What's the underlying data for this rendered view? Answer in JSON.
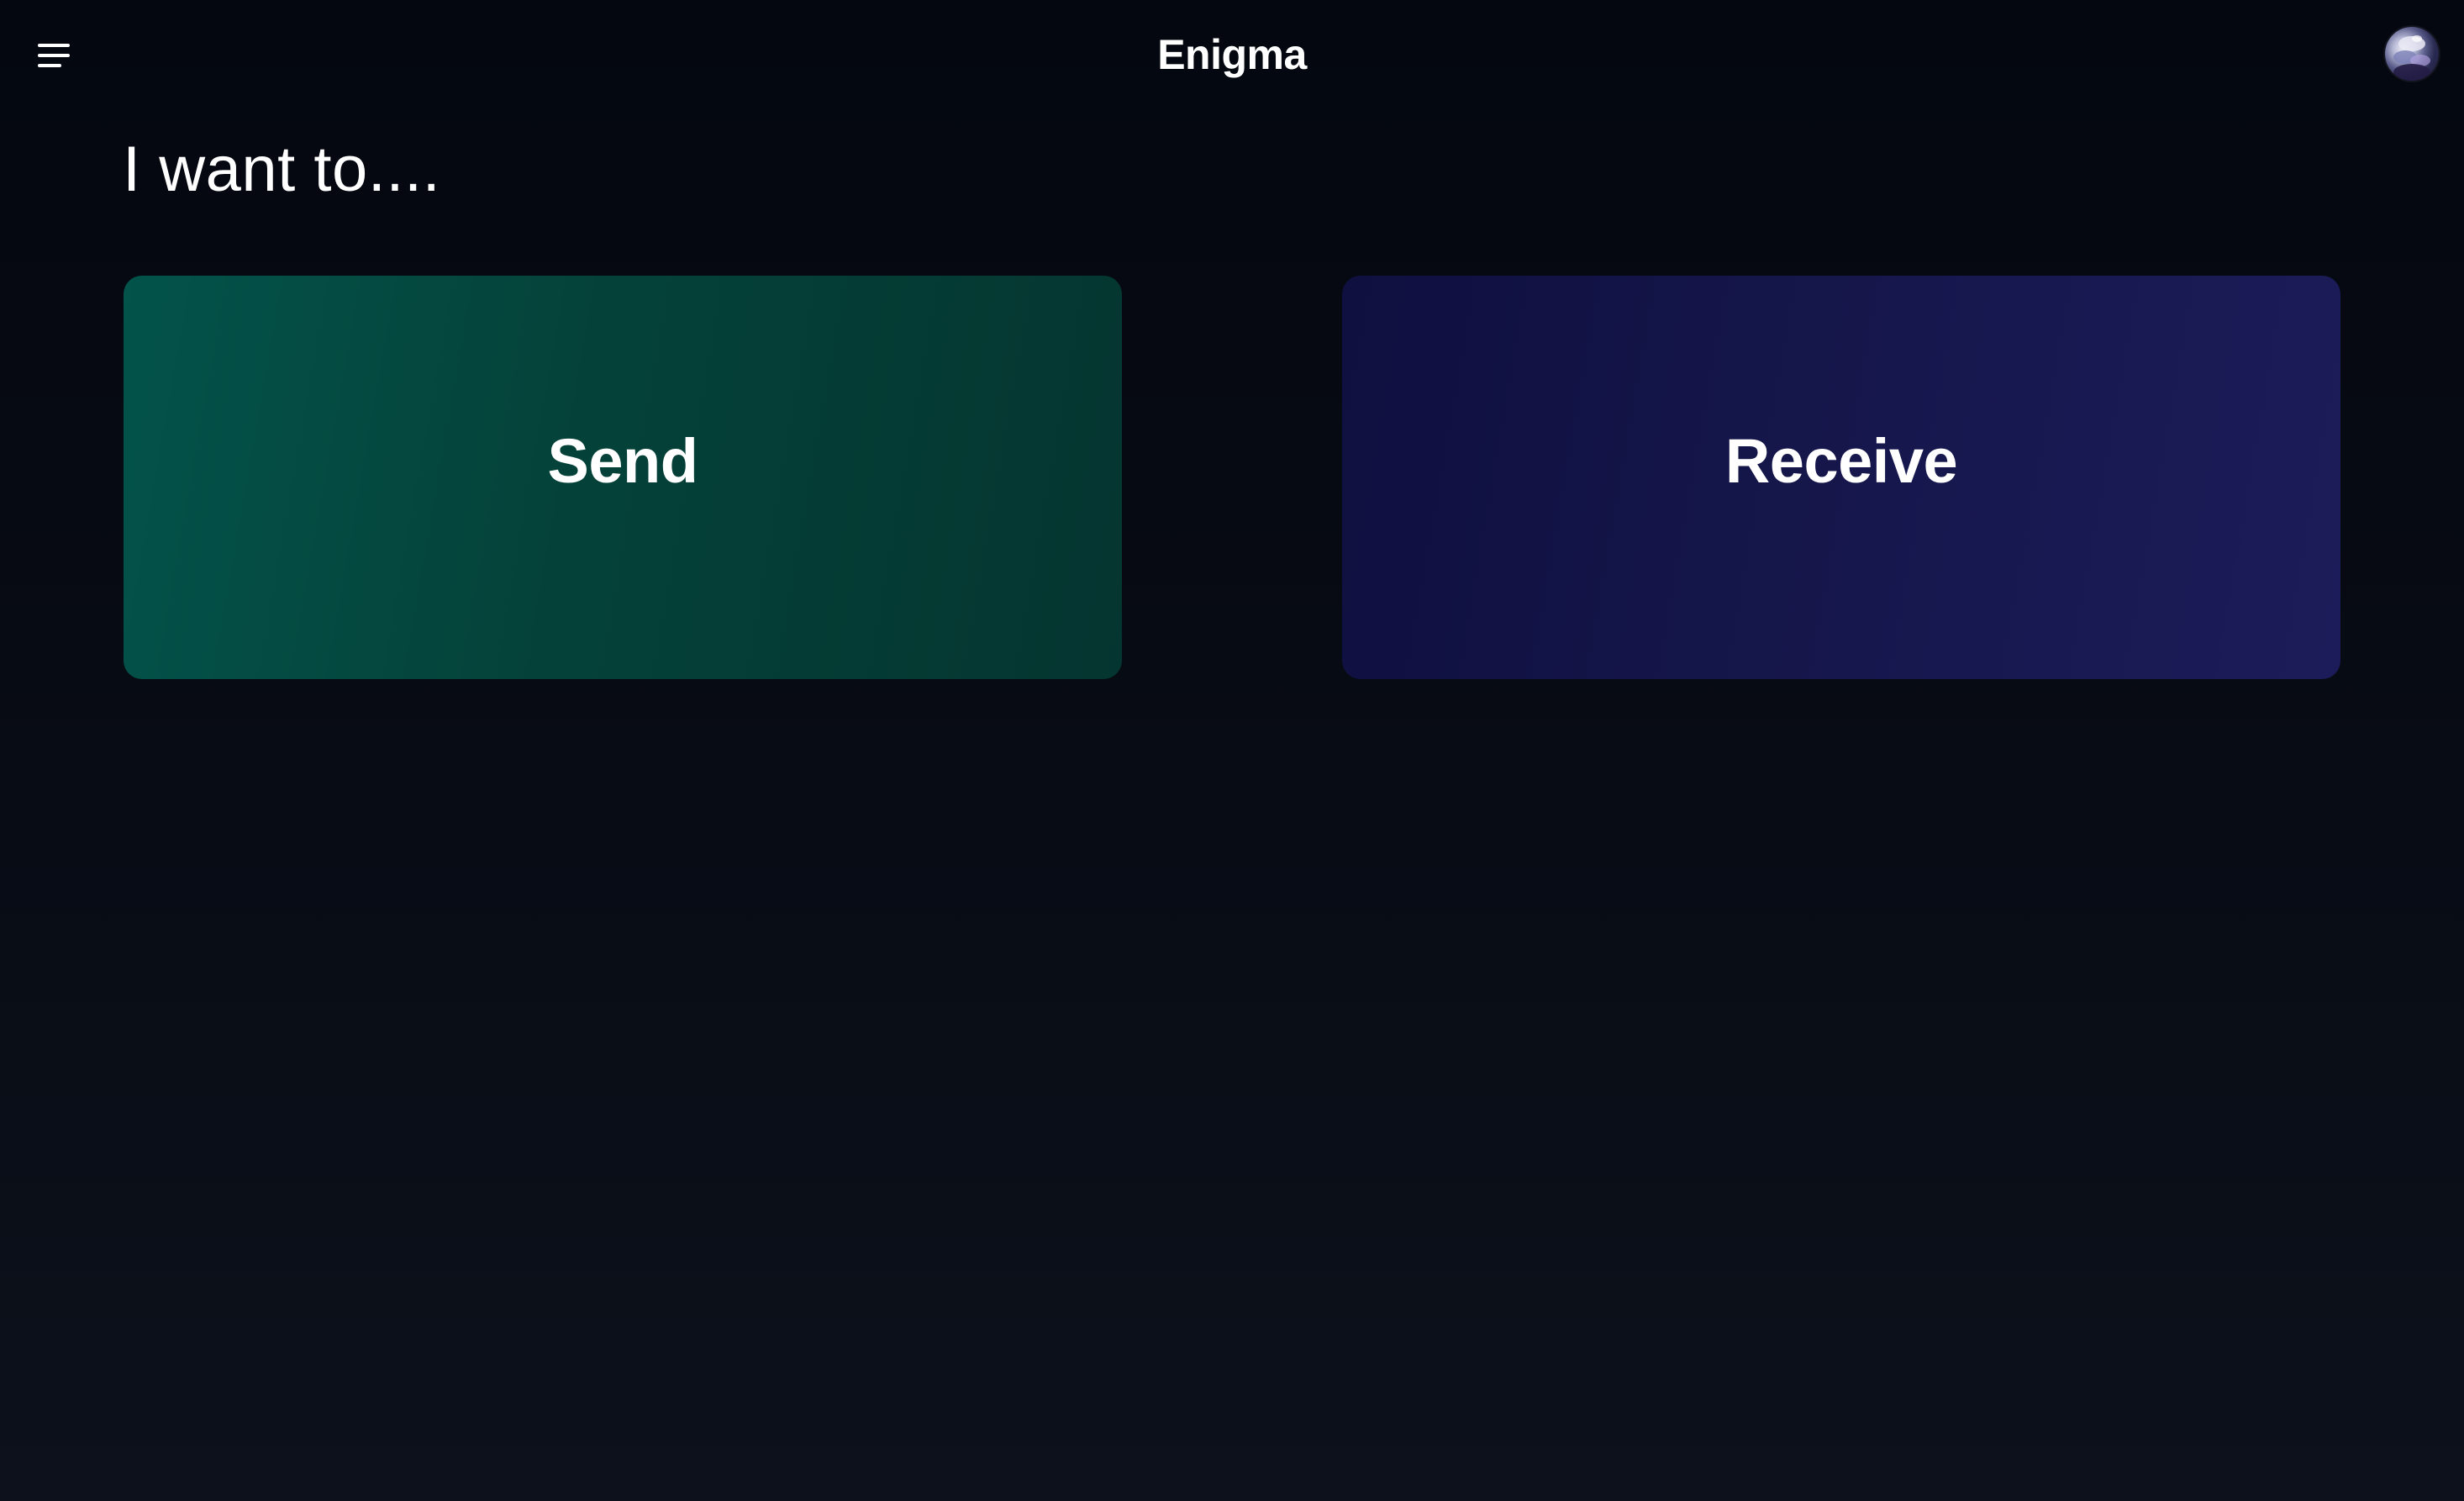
{
  "header": {
    "title": "Enigma",
    "menu_icon": "hamburger-menu-icon",
    "avatar_icon": "user-avatar"
  },
  "main": {
    "prompt": "I want to....",
    "actions": [
      {
        "label": "Send",
        "color": "#03534b"
      },
      {
        "label": "Receive",
        "color": "#15164a"
      }
    ]
  },
  "theme": {
    "background": "#04070f",
    "text": "#ffffff"
  }
}
